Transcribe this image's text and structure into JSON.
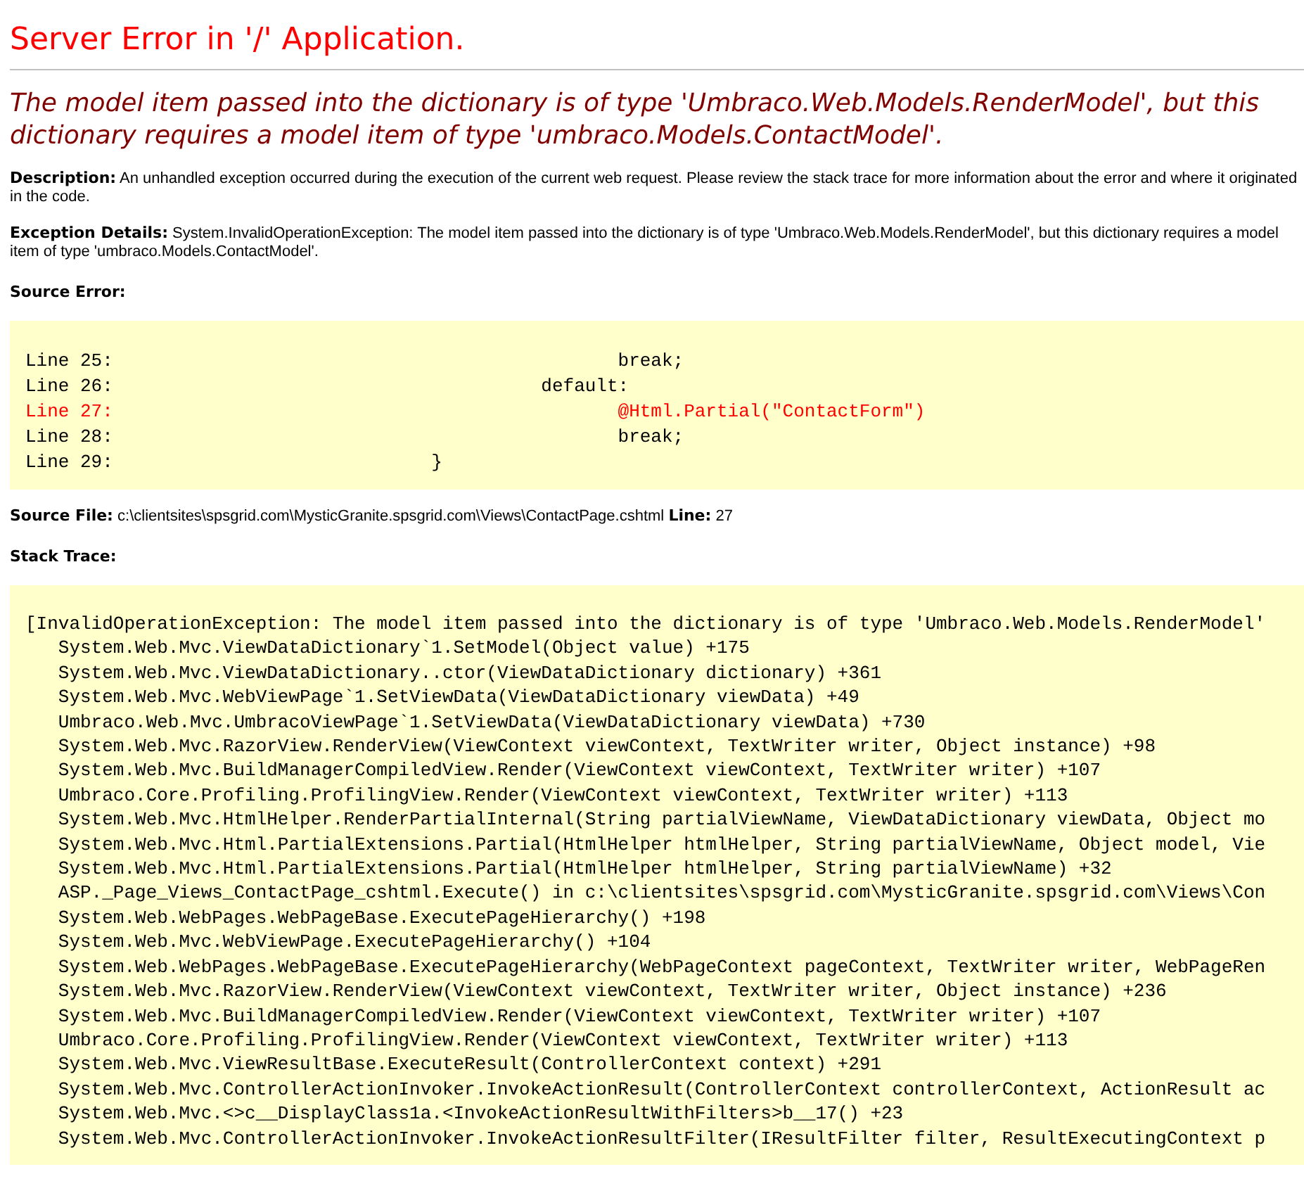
{
  "title": "Server Error in '/' Application.",
  "message": "The model item passed into the dictionary is of type 'Umbraco.Web.Models.RenderModel', but this dictionary requires a model item of type 'umbraco.Models.ContactModel'.",
  "description": "**Description:** An unhandled exception occurred during the execution of the current web request. Please review the stack trace for more information about the error and where it originated in the code.",
  "exception_details": "**Exception Details:** System.InvalidOperationException: The model item passed into the dictionary is of type 'Umbraco.Web.Models.RenderModel', but this dictionary requires a model item of type 'umbraco.Models.ContactModel'.",
  "source_error": {
    "heading": "Source Error:",
    "lines": [
      {
        "text": "Line 25:                                              break;",
        "highlighted": false
      },
      {
        "text": "Line 26:                                       default:",
        "highlighted": false
      },
      {
        "text": "Line 27:                                              @Html.Partial(\"ContactForm\")",
        "highlighted": true
      },
      {
        "text": "Line 28:                                              break;",
        "highlighted": false
      },
      {
        "text": "Line 29:                             }",
        "highlighted": false
      }
    ]
  },
  "source_file": "**Source File:** c:\\clientsites\\spsgrid.com\\MysticGranite.spsgrid.com\\Views\\ContactPage.cshtml    **Line:** 27",
  "stack_trace": {
    "heading": "Stack Trace:",
    "lines": [
      "[InvalidOperationException: The model item passed into the dictionary is of type 'Umbraco.Web.Models.RenderModel'",
      "   System.Web.Mvc.ViewDataDictionary`1.SetModel(Object value) +175",
      "   System.Web.Mvc.ViewDataDictionary..ctor(ViewDataDictionary dictionary) +361",
      "   System.Web.Mvc.WebViewPage`1.SetViewData(ViewDataDictionary viewData) +49",
      "   Umbraco.Web.Mvc.UmbracoViewPage`1.SetViewData(ViewDataDictionary viewData) +730",
      "   System.Web.Mvc.RazorView.RenderView(ViewContext viewContext, TextWriter writer, Object instance) +98",
      "   System.Web.Mvc.BuildManagerCompiledView.Render(ViewContext viewContext, TextWriter writer) +107",
      "   Umbraco.Core.Profiling.ProfilingView.Render(ViewContext viewContext, TextWriter writer) +113",
      "   System.Web.Mvc.HtmlHelper.RenderPartialInternal(String partialViewName, ViewDataDictionary viewData, Object mo",
      "   System.Web.Mvc.Html.PartialExtensions.Partial(HtmlHelper htmlHelper, String partialViewName, Object model, Vie",
      "   System.Web.Mvc.Html.PartialExtensions.Partial(HtmlHelper htmlHelper, String partialViewName) +32",
      "   ASP._Page_Views_ContactPage_cshtml.Execute() in c:\\clientsites\\spsgrid.com\\MysticGranite.spsgrid.com\\Views\\Con",
      "   System.Web.WebPages.WebPageBase.ExecutePageHierarchy() +198",
      "   System.Web.Mvc.WebViewPage.ExecutePageHierarchy() +104",
      "   System.Web.WebPages.WebPageBase.ExecutePageHierarchy(WebPageContext pageContext, TextWriter writer, WebPageRen",
      "   System.Web.Mvc.RazorView.RenderView(ViewContext viewContext, TextWriter writer, Object instance) +236",
      "   System.Web.Mvc.BuildManagerCompiledView.Render(ViewContext viewContext, TextWriter writer) +107",
      "   Umbraco.Core.Profiling.ProfilingView.Render(ViewContext viewContext, TextWriter writer) +113",
      "   System.Web.Mvc.ViewResultBase.ExecuteResult(ControllerContext context) +291",
      "   System.Web.Mvc.ControllerActionInvoker.InvokeActionResult(ControllerContext controllerContext, ActionResult ac",
      "   System.Web.Mvc.<>c__DisplayClass1a.<InvokeActionResultWithFilters>b__17() +23",
      "   System.Web.Mvc.ControllerActionInvoker.InvokeActionResultFilter(IResultFilter filter, ResultExecutingContext p"
    ]
  }
}
